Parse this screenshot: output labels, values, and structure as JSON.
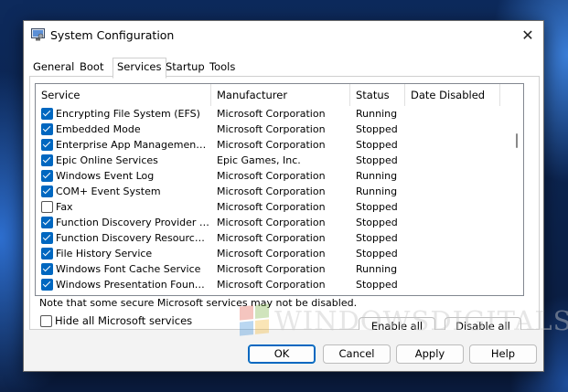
{
  "window": {
    "title": "System Configuration",
    "icon": "system-configuration-icon",
    "close_glyph": "✕"
  },
  "tabs": [
    {
      "label": "General",
      "active": false
    },
    {
      "label": "Boot",
      "active": false
    },
    {
      "label": "Services",
      "active": true
    },
    {
      "label": "Startup",
      "active": false
    },
    {
      "label": "Tools",
      "active": false
    }
  ],
  "columns": [
    "Service",
    "Manufacturer",
    "Status",
    "Date Disabled"
  ],
  "rows": [
    {
      "checked": true,
      "service": "Encrypting File System (EFS)",
      "manufacturer": "Microsoft Corporation",
      "status": "Running",
      "date": ""
    },
    {
      "checked": true,
      "service": "Embedded Mode",
      "manufacturer": "Microsoft Corporation",
      "status": "Stopped",
      "date": ""
    },
    {
      "checked": true,
      "service": "Enterprise App Management Ser...",
      "manufacturer": "Microsoft Corporation",
      "status": "Stopped",
      "date": ""
    },
    {
      "checked": true,
      "service": "Epic Online Services",
      "manufacturer": "Epic Games, Inc.",
      "status": "Stopped",
      "date": ""
    },
    {
      "checked": true,
      "service": "Windows Event Log",
      "manufacturer": "Microsoft Corporation",
      "status": "Running",
      "date": ""
    },
    {
      "checked": true,
      "service": "COM+ Event System",
      "manufacturer": "Microsoft Corporation",
      "status": "Running",
      "date": ""
    },
    {
      "checked": false,
      "service": "Fax",
      "manufacturer": "Microsoft Corporation",
      "status": "Stopped",
      "date": ""
    },
    {
      "checked": true,
      "service": "Function Discovery Provider Host",
      "manufacturer": "Microsoft Corporation",
      "status": "Stopped",
      "date": ""
    },
    {
      "checked": true,
      "service": "Function Discovery Resource Pu...",
      "manufacturer": "Microsoft Corporation",
      "status": "Stopped",
      "date": ""
    },
    {
      "checked": true,
      "service": "File History Service",
      "manufacturer": "Microsoft Corporation",
      "status": "Stopped",
      "date": ""
    },
    {
      "checked": true,
      "service": "Windows Font Cache Service",
      "manufacturer": "Microsoft Corporation",
      "status": "Running",
      "date": ""
    },
    {
      "checked": true,
      "service": "Windows Presentation Foundati...",
      "manufacturer": "Microsoft Corporation",
      "status": "Stopped",
      "date": ""
    }
  ],
  "note": "Note that some secure Microsoft services may not be disabled.",
  "enable_all": "Enable all",
  "disable_all": "Disable all",
  "hide_ms_label": "Hide all Microsoft services",
  "hide_ms_checked": false,
  "footer": {
    "ok": "OK",
    "cancel": "Cancel",
    "apply": "Apply",
    "help": "Help"
  },
  "watermark": "WINDOWSDIGITALS.COM",
  "colors": {
    "accent": "#0067c0",
    "window_bg": "#f3f3f3",
    "checkbox_on": "#0067c0"
  }
}
